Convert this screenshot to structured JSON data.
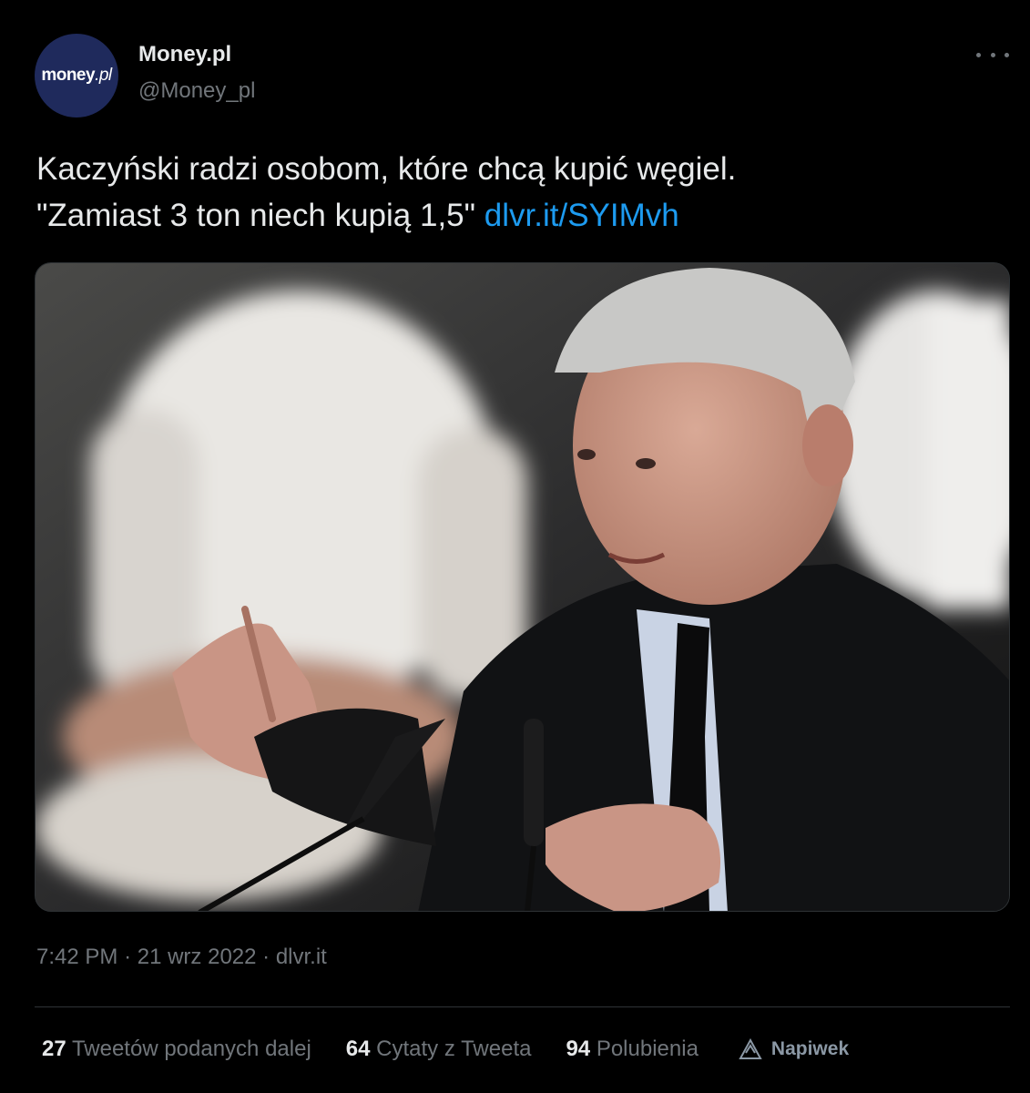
{
  "author": {
    "avatar_text": "money",
    "avatar_text_suffix": ".pl",
    "name": "Money.pl",
    "handle": "@Money_pl"
  },
  "tweet": {
    "text_line1": "Kaczyński radzi osobom, które chcą kupić węgiel.",
    "text_line2": "\"Zamiast 3 ton niech kupią 1,5\"",
    "link": "dlvr.it/SYIMvh"
  },
  "meta": {
    "time": "7:42 PM",
    "date": "21 wrz 2022",
    "source": "dlvr.it",
    "separator": "·"
  },
  "stats": {
    "retweets_count": "27",
    "retweets_label": "Tweetów podanych dalej",
    "quotes_count": "64",
    "quotes_label": "Cytaty z Tweeta",
    "likes_count": "94",
    "likes_label": "Polubienia",
    "tip_label": "Napiwek"
  },
  "colors": {
    "background": "#000000",
    "text": "#e7e9ea",
    "muted": "#71767b",
    "link": "#1d9bf0",
    "avatar_bg": "#1f2a5c"
  }
}
